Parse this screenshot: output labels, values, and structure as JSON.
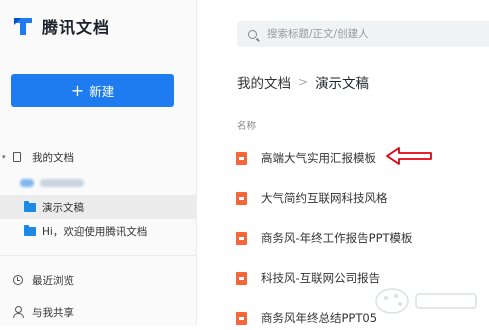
{
  "app": {
    "name": "腾讯文档"
  },
  "sidebar": {
    "new_button_label": "新建",
    "new_button_plus": "+",
    "my_docs": "我的文档",
    "tree_caret": "▾",
    "folders": [
      {
        "label": "演示文稿"
      },
      {
        "label": "Hi，欢迎使用腾讯文档"
      }
    ],
    "recent": "最近浏览",
    "shared": "与我共享"
  },
  "search": {
    "placeholder": "搜索标题/正文/创建人",
    "value": ""
  },
  "breadcrumb": {
    "root": "我的文档",
    "separator": ">",
    "current": "演示文稿"
  },
  "list": {
    "column_name": "名称",
    "files": [
      {
        "name": "高端大气实用汇报模板"
      },
      {
        "name": "大气简约互联网科技风格"
      },
      {
        "name": "商务风-年终工作报告PPT模板"
      },
      {
        "name": "科技风-互联网公司报告"
      },
      {
        "name": "商务风年终总结PPT05"
      }
    ]
  },
  "colors": {
    "accent": "#1e7cf0",
    "file_icon": "#f5673a",
    "annotation_arrow": "#e60012"
  },
  "icons": [
    "logo-icon",
    "plus-icon",
    "doc-icon",
    "folder-icon",
    "clock-icon",
    "person-icon",
    "search-icon",
    "ppt-file-icon",
    "arrow-annotation-icon"
  ]
}
